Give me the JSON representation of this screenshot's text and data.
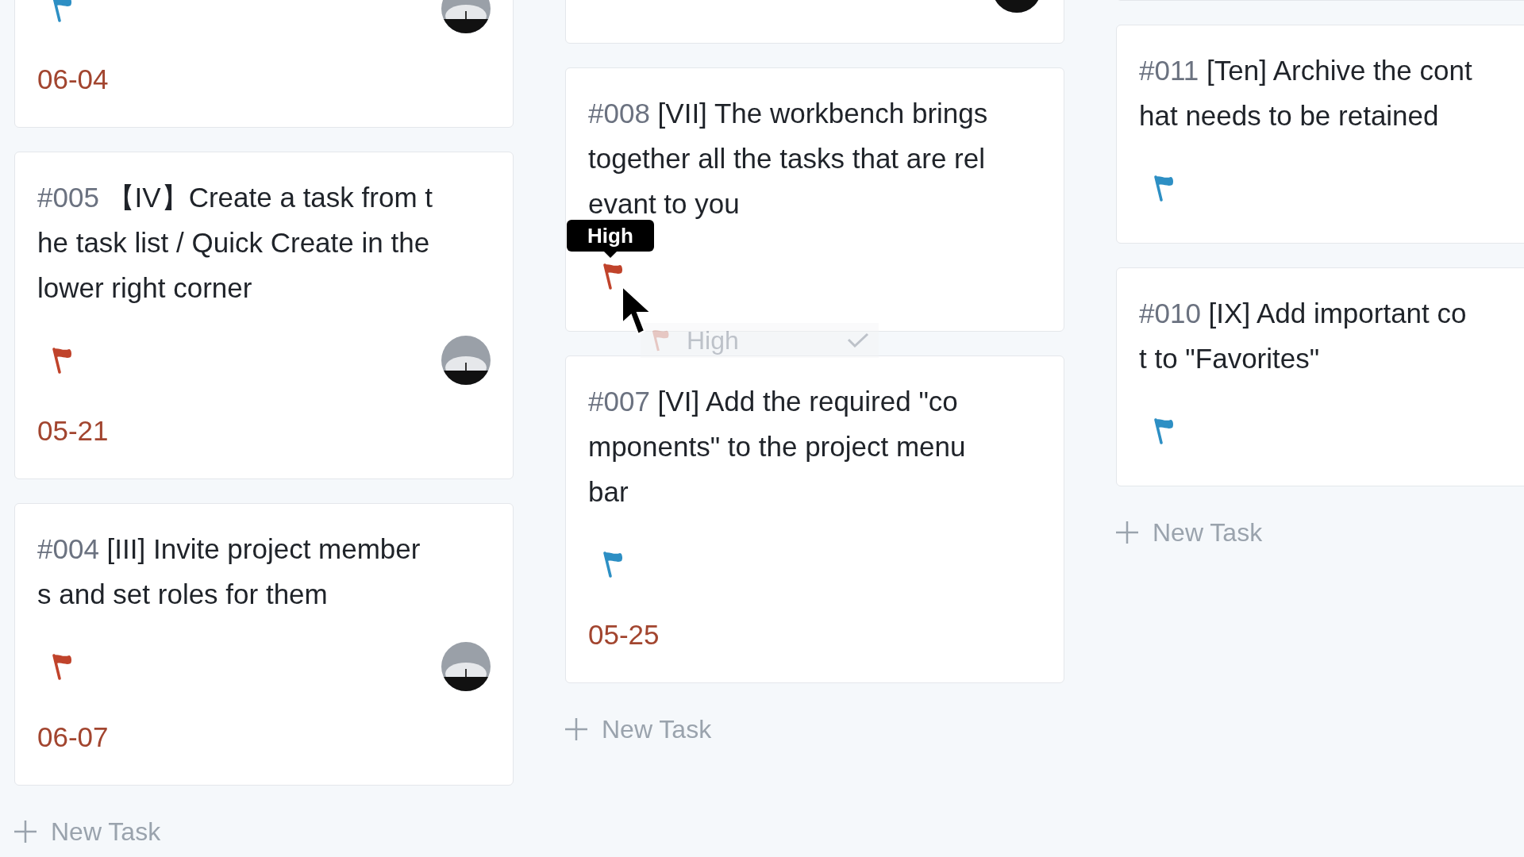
{
  "columns": [
    {
      "cards": [
        {
          "flag": {
            "color": "#2d8fc4"
          },
          "has_avatar": true,
          "date": "06-04"
        },
        {
          "id": "#005",
          "title_lines": [
            "【IV】Create a task from t",
            "he task list / Quick Create in the",
            "lower right corner"
          ],
          "flag": {
            "color": "#c0432b"
          },
          "has_avatar": true,
          "date": "05-21"
        },
        {
          "id": "#004",
          "title_lines": [
            "[III] Invite project member",
            "s and set roles for them"
          ],
          "flag": {
            "color": "#c0432b"
          },
          "has_avatar": true,
          "date": "06-07"
        }
      ],
      "new_task": "New Task"
    },
    {
      "cards": [
        {
          "has_avatar": true
        },
        {
          "id": "#008",
          "title_lines": [
            "[VII] The workbench brings",
            "together all the tasks that are rel",
            "evant to you"
          ],
          "flag": {
            "color": "#c0432b"
          },
          "has_avatar": false,
          "tooltip": "High",
          "menu": [
            {
              "label": "High",
              "selected": true
            }
          ]
        },
        {
          "id": "#007",
          "title_lines": [
            "[VI] Add the required \"co",
            "mponents\" to the project menu",
            "bar"
          ],
          "flag": {
            "color": "#2d8fc4"
          },
          "has_avatar": false,
          "date": "05-25"
        }
      ],
      "new_task": "New Task"
    },
    {
      "cards": [
        {
          "has_avatar": false
        },
        {
          "id": "#011",
          "title_lines": [
            "[Ten] Archive the cont",
            "hat needs to be retained"
          ],
          "flag": {
            "color": "#2d8fc4"
          },
          "has_avatar": false
        },
        {
          "id": "#010",
          "title_lines": [
            "[IX] Add important co",
            "t to \"Favorites\""
          ],
          "flag": {
            "color": "#2d8fc4"
          },
          "has_avatar": false
        }
      ],
      "new_task": "New Task"
    }
  ]
}
